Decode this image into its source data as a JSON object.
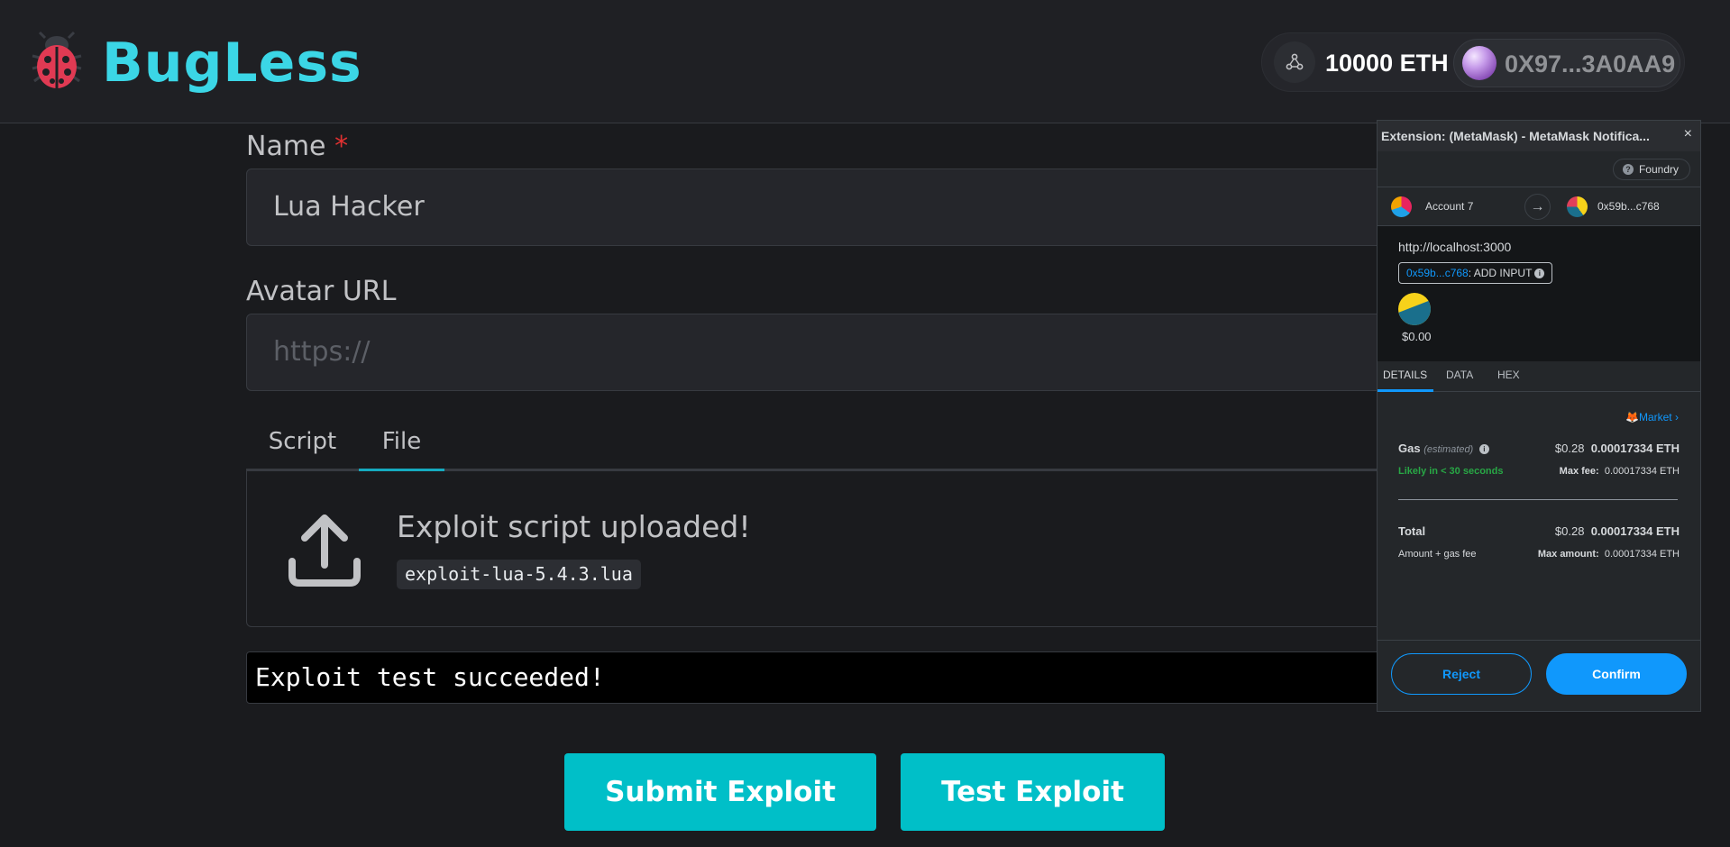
{
  "header": {
    "brand": "BugLess",
    "balance": "10000 ETH",
    "account": "0X97...3A0AA9",
    "logo_icon": "ladybug-icon",
    "network_icon": "network-icon"
  },
  "form": {
    "name_label": "Name",
    "required_mark": "*",
    "name_value": "Lua Hacker",
    "avatar_label": "Avatar URL",
    "avatar_placeholder": "https://",
    "tabs": [
      {
        "label": "Script",
        "active": false
      },
      {
        "label": "File",
        "active": true
      }
    ],
    "upload_title": "Exploit script uploaded!",
    "file_name": "exploit-lua-5.4.3.lua",
    "console_output": "Exploit test succeeded!",
    "submit_label": "Submit Exploit",
    "test_label": "Test Exploit"
  },
  "metamask": {
    "window_title": "Extension: (MetaMask) - MetaMask Notifica...",
    "close": "×",
    "network": "Foundry",
    "from_account": "Account 7",
    "to_account": "0x59b...c768",
    "origin": "http://localhost:3000",
    "chip_address": "0x59b...c768",
    "chip_action": ": ADD INPUT",
    "amount": "$0.00",
    "tabs": [
      "DETAILS",
      "DATA",
      "HEX"
    ],
    "market": "Market",
    "gas_label": "Gas",
    "gas_estimated": "(estimated)",
    "gas_fiat": "$0.28",
    "gas_eth": "0.00017334 ETH",
    "likely": "Likely in < 30 seconds",
    "max_fee_label": "Max fee:",
    "max_fee_value": "0.00017334 ETH",
    "total_label": "Total",
    "total_fiat": "$0.28",
    "total_eth": "0.00017334 ETH",
    "amount_gas_label": "Amount + gas fee",
    "max_amount_label": "Max amount:",
    "max_amount_value": "0.00017334 ETH",
    "reject_label": "Reject",
    "confirm_label": "Confirm"
  },
  "colors": {
    "background": "#1a1b1e",
    "brand": "#3bd6e6",
    "accent": "#00bfc8",
    "metamask_blue": "#1098fc",
    "tab_active": "#15aabf"
  }
}
